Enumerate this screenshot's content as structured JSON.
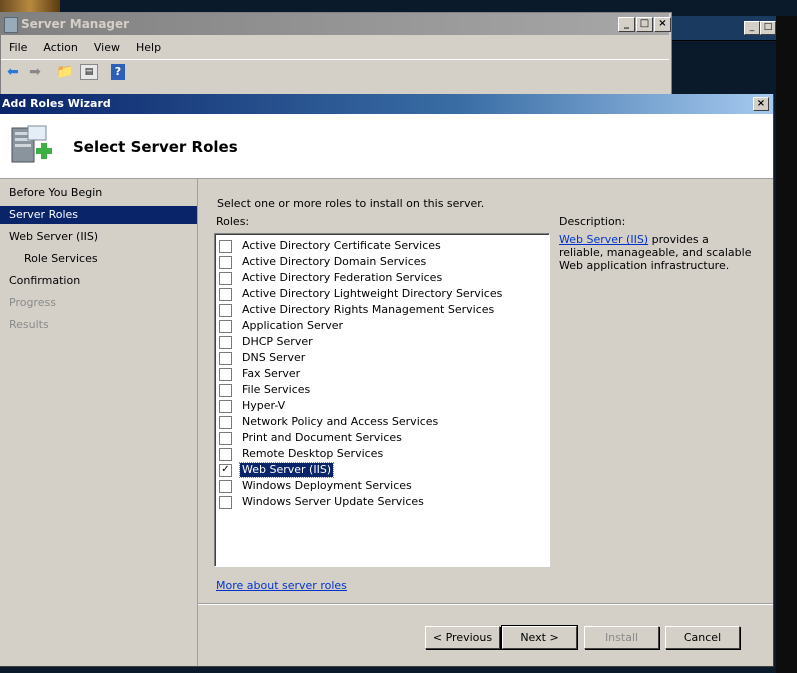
{
  "server_manager": {
    "title": "Server Manager",
    "menu": [
      "File",
      "Action",
      "View",
      "Help"
    ]
  },
  "wizard": {
    "title": "Add Roles Wizard",
    "heading": "Select Server Roles",
    "nav": [
      {
        "label": "Before You Begin",
        "state": "normal"
      },
      {
        "label": "Server Roles",
        "state": "active"
      },
      {
        "label": "Web Server (IIS)",
        "state": "normal"
      },
      {
        "label": "Role Services",
        "state": "sub"
      },
      {
        "label": "Confirmation",
        "state": "normal"
      },
      {
        "label": "Progress",
        "state": "disabled"
      },
      {
        "label": "Results",
        "state": "disabled"
      }
    ],
    "instruction": "Select one or more roles to install on this server.",
    "roles_label": "Roles:",
    "roles": [
      {
        "label": "Active Directory Certificate Services",
        "checked": false
      },
      {
        "label": "Active Directory Domain Services",
        "checked": false
      },
      {
        "label": "Active Directory Federation Services",
        "checked": false
      },
      {
        "label": "Active Directory Lightweight Directory Services",
        "checked": false
      },
      {
        "label": "Active Directory Rights Management Services",
        "checked": false
      },
      {
        "label": "Application Server",
        "checked": false
      },
      {
        "label": "DHCP Server",
        "checked": false
      },
      {
        "label": "DNS Server",
        "checked": false
      },
      {
        "label": "Fax Server",
        "checked": false
      },
      {
        "label": "File Services",
        "checked": false
      },
      {
        "label": "Hyper-V",
        "checked": false
      },
      {
        "label": "Network Policy and Access Services",
        "checked": false
      },
      {
        "label": "Print and Document Services",
        "checked": false
      },
      {
        "label": "Remote Desktop Services",
        "checked": false
      },
      {
        "label": "Web Server (IIS)",
        "checked": true
      },
      {
        "label": "Windows Deployment Services",
        "checked": false
      },
      {
        "label": "Windows Server Update Services",
        "checked": false
      }
    ],
    "description_label": "Description:",
    "description_link": "Web Server (IIS)",
    "description_text": " provides a reliable, manageable, and scalable Web application infrastructure.",
    "more_link": "More about server roles",
    "buttons": {
      "previous": "< Previous",
      "next": "Next >",
      "install": "Install",
      "cancel": "Cancel"
    }
  },
  "colors": {
    "selection": "#0a246a",
    "link": "#0033cc",
    "dialog_bg": "#d4d0c8"
  }
}
